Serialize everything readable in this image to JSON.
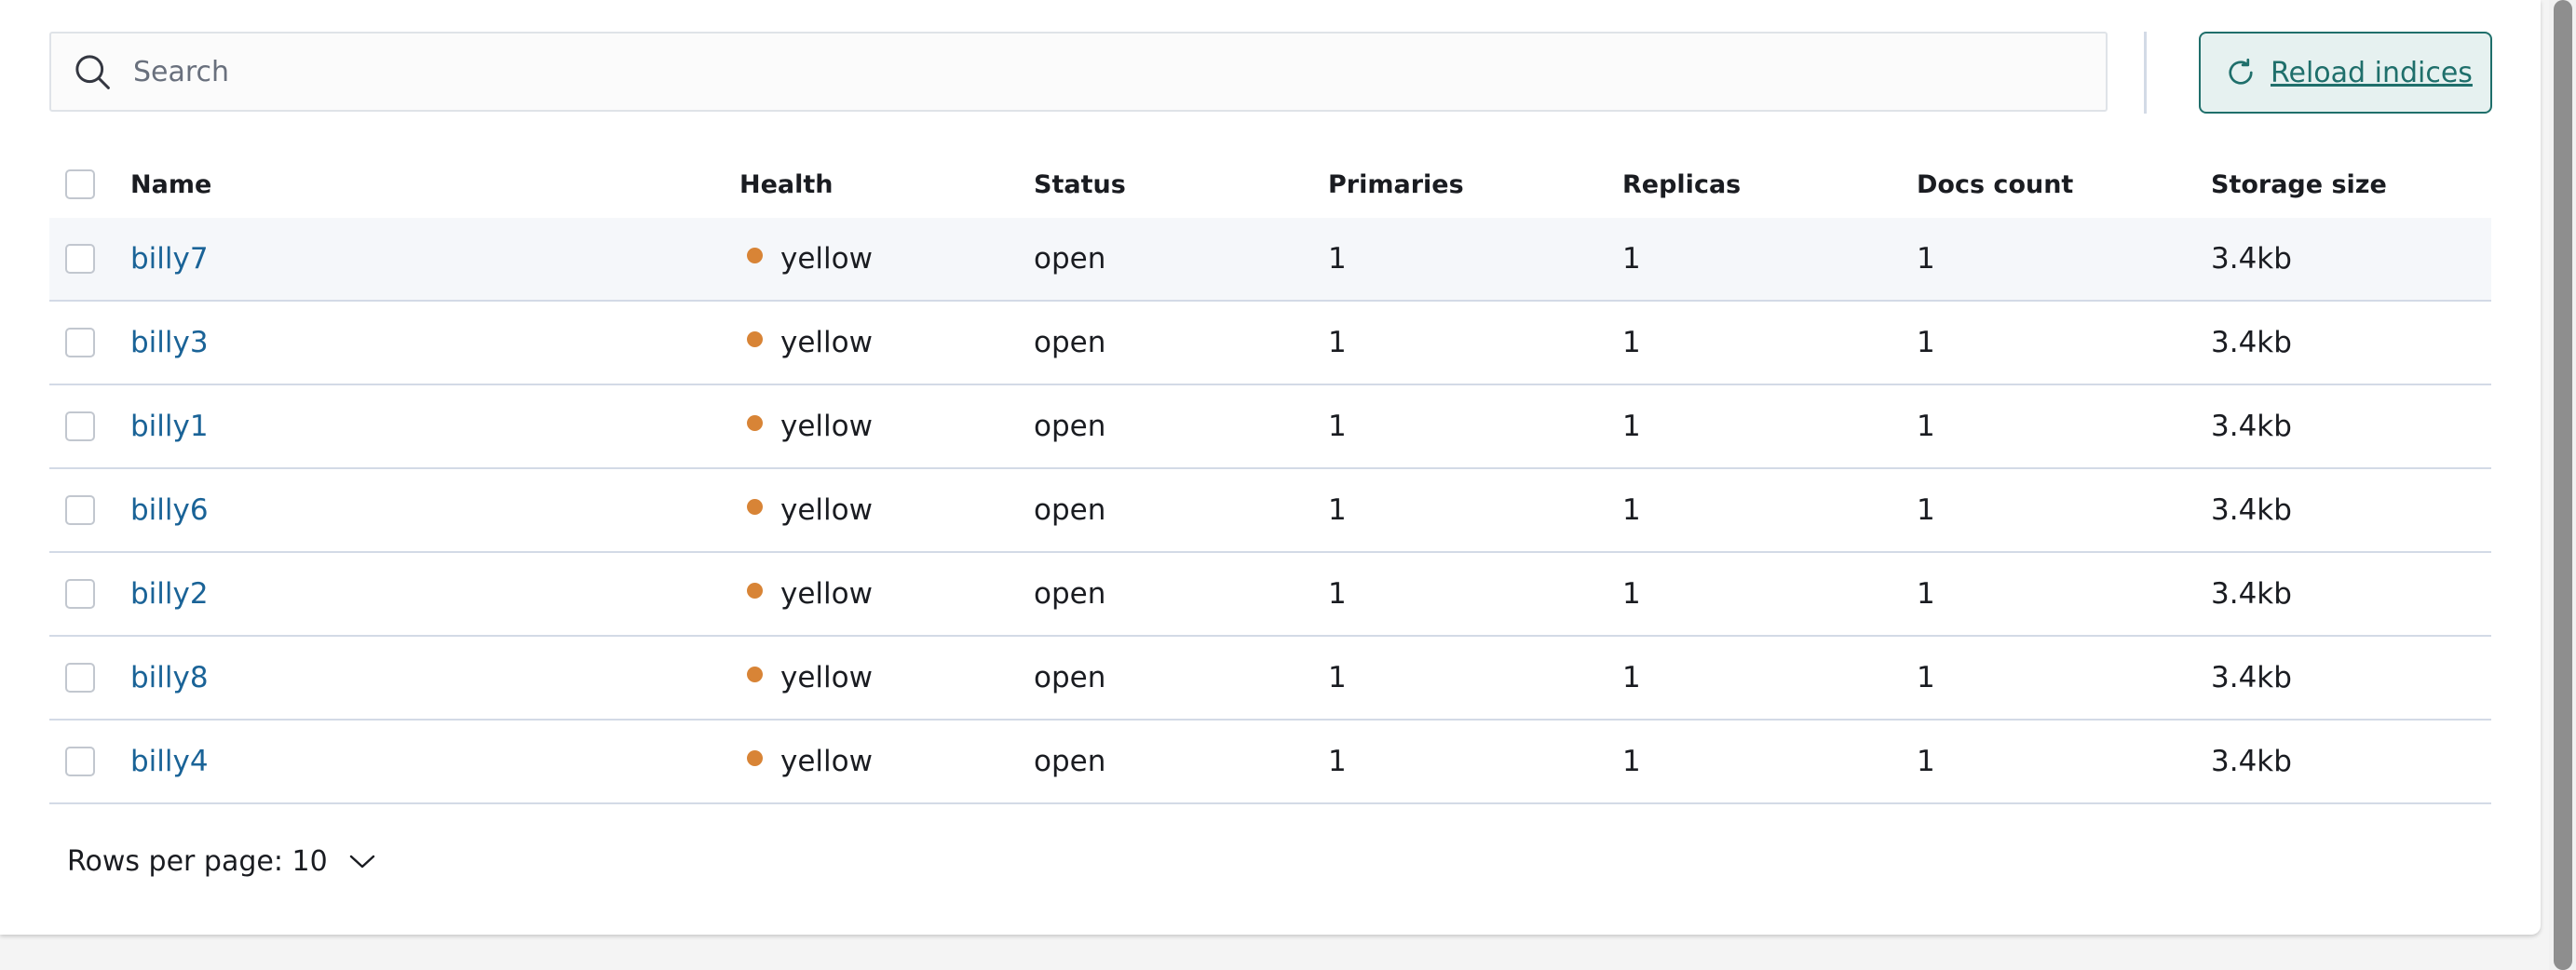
{
  "search": {
    "placeholder": "Search",
    "value": ""
  },
  "toolbar": {
    "reload_label": "Reload indices"
  },
  "table": {
    "columns": {
      "name": "Name",
      "health": "Health",
      "status": "Status",
      "primaries": "Primaries",
      "replicas": "Replicas",
      "docs_count": "Docs count",
      "storage_size": "Storage size"
    },
    "rows": [
      {
        "name": "billy7",
        "health": "yellow",
        "status": "open",
        "primaries": "1",
        "replicas": "1",
        "docs_count": "1",
        "storage_size": "3.4kb"
      },
      {
        "name": "billy3",
        "health": "yellow",
        "status": "open",
        "primaries": "1",
        "replicas": "1",
        "docs_count": "1",
        "storage_size": "3.4kb"
      },
      {
        "name": "billy1",
        "health": "yellow",
        "status": "open",
        "primaries": "1",
        "replicas": "1",
        "docs_count": "1",
        "storage_size": "3.4kb"
      },
      {
        "name": "billy6",
        "health": "yellow",
        "status": "open",
        "primaries": "1",
        "replicas": "1",
        "docs_count": "1",
        "storage_size": "3.4kb"
      },
      {
        "name": "billy2",
        "health": "yellow",
        "status": "open",
        "primaries": "1",
        "replicas": "1",
        "docs_count": "1",
        "storage_size": "3.4kb"
      },
      {
        "name": "billy8",
        "health": "yellow",
        "status": "open",
        "primaries": "1",
        "replicas": "1",
        "docs_count": "1",
        "storage_size": "3.4kb"
      },
      {
        "name": "billy4",
        "health": "yellow",
        "status": "open",
        "primaries": "1",
        "replicas": "1",
        "docs_count": "1",
        "storage_size": "3.4kb"
      }
    ]
  },
  "pagination": {
    "rows_per_page_label": "Rows per page: 10"
  },
  "colors": {
    "accent": "#1f6f6b",
    "link": "#1a6397",
    "health_yellow": "#d88436"
  },
  "icons": {
    "search": "search-icon",
    "reload": "refresh-icon",
    "pager": "chevron-down-icon"
  }
}
